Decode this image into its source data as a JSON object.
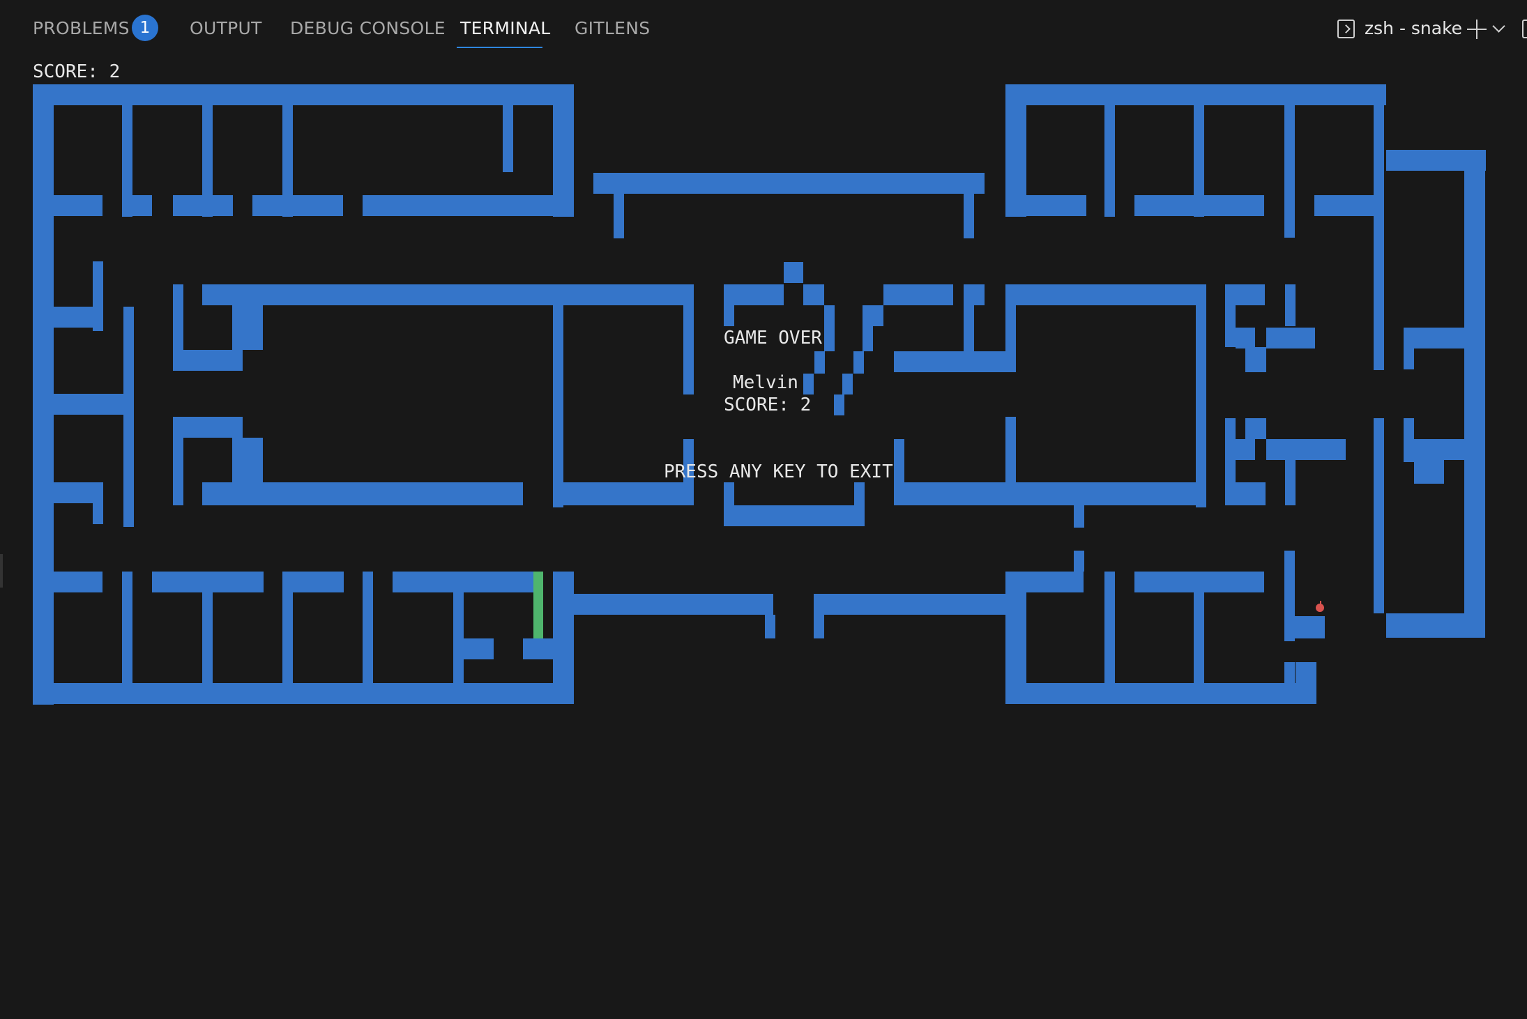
{
  "panel": {
    "tabs": [
      {
        "label": "PROBLEMS",
        "badge": "1"
      },
      {
        "label": "OUTPUT"
      },
      {
        "label": "DEBUG CONSOLE"
      },
      {
        "label": "TERMINAL",
        "active": true
      },
      {
        "label": "GITLENS"
      }
    ],
    "terminal_title": "zsh - snake"
  },
  "game": {
    "score_header": "SCORE: 2",
    "overlay": {
      "game_over": "GAME OVER",
      "player": "Melvin",
      "score": "SCORE: 2",
      "exit_prompt": "PRESS ANY KEY TO EXIT"
    },
    "colors": {
      "wall": "#3575c9",
      "snake": "#4fb56d",
      "food": "#d9534f",
      "background": "#181818"
    },
    "icons": [
      "terminal-icon",
      "plus-icon",
      "chevron-down-icon",
      "apple-icon"
    ]
  }
}
